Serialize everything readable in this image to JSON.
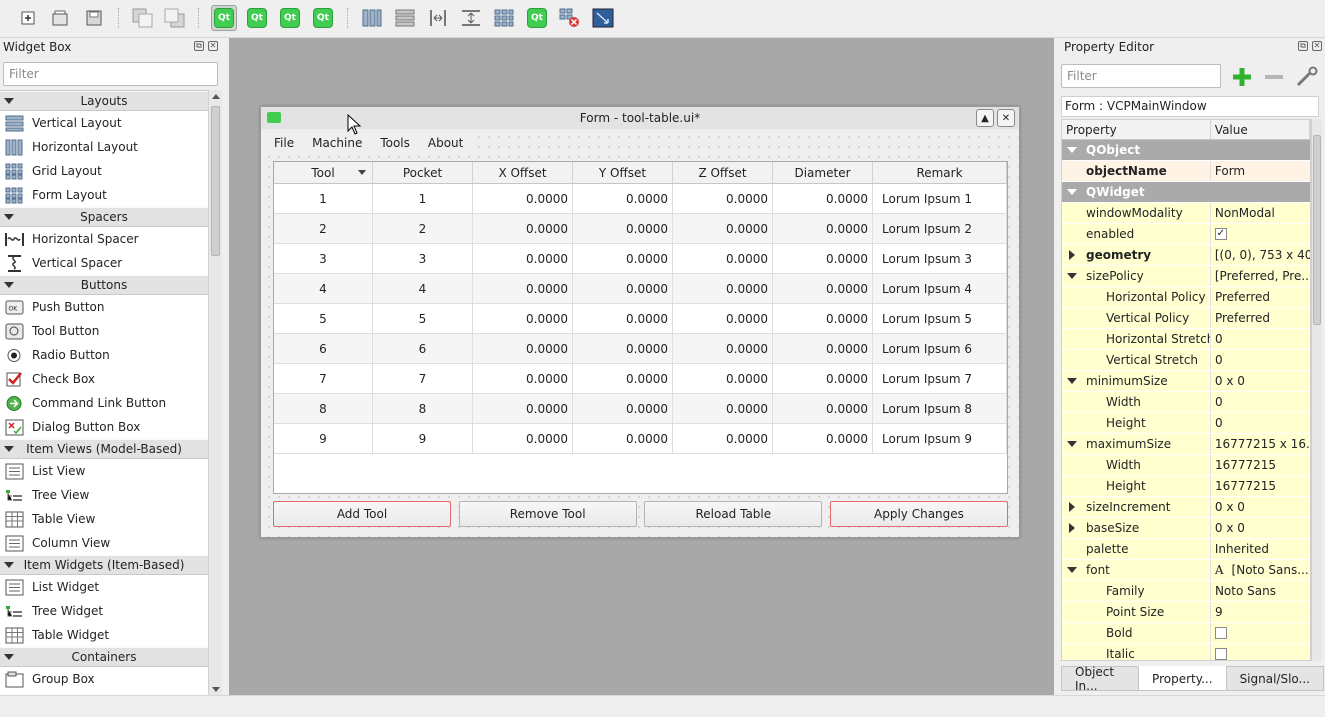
{
  "toolbar": {
    "buttons": [
      "new-form-icon",
      "open-form-icon",
      "save-form-icon",
      "send-to-back-icon",
      "bring-to-front-icon",
      "edit-widgets-icon",
      "edit-signals-slots-icon",
      "edit-buddies-icon",
      "edit-tab-order-icon",
      "layout-horizontally-icon",
      "layout-vertically-icon",
      "layout-horizontal-splitter-icon",
      "layout-vertical-splitter-icon",
      "layout-grid-icon",
      "layout-form-icon",
      "break-layout-icon",
      "adjust-size-icon"
    ],
    "qt_badge_text": "Qt"
  },
  "widget_box": {
    "title": "Widget Box",
    "filter_placeholder": "Filter",
    "categories": [
      {
        "label": "Layouts",
        "items": [
          "Vertical Layout",
          "Horizontal Layout",
          "Grid Layout",
          "Form Layout"
        ]
      },
      {
        "label": "Spacers",
        "items": [
          "Horizontal Spacer",
          "Vertical Spacer"
        ]
      },
      {
        "label": "Buttons",
        "items": [
          "Push Button",
          "Tool Button",
          "Radio Button",
          "Check Box",
          "Command Link Button",
          "Dialog Button Box"
        ]
      },
      {
        "label": "Item Views (Model-Based)",
        "items": [
          "List View",
          "Tree View",
          "Table View",
          "Column View"
        ]
      },
      {
        "label": "Item Widgets (Item-Based)",
        "items": [
          "List Widget",
          "Tree Widget",
          "Table Widget"
        ]
      },
      {
        "label": "Containers",
        "items": [
          "Group Box"
        ]
      }
    ]
  },
  "form": {
    "title": "Form - tool-table.ui*",
    "menu": [
      "File",
      "Machine",
      "Tools",
      "About"
    ],
    "table": {
      "headers": [
        "Tool",
        "Pocket",
        "X Offset",
        "Y Offset",
        "Z Offset",
        "Diameter",
        "Remark"
      ],
      "rows": [
        [
          "1",
          "1",
          "0.0000",
          "0.0000",
          "0.0000",
          "0.0000",
          "Lorum Ipsum 1"
        ],
        [
          "2",
          "2",
          "0.0000",
          "0.0000",
          "0.0000",
          "0.0000",
          "Lorum Ipsum 2"
        ],
        [
          "3",
          "3",
          "0.0000",
          "0.0000",
          "0.0000",
          "0.0000",
          "Lorum Ipsum 3"
        ],
        [
          "4",
          "4",
          "0.0000",
          "0.0000",
          "0.0000",
          "0.0000",
          "Lorum Ipsum 4"
        ],
        [
          "5",
          "5",
          "0.0000",
          "0.0000",
          "0.0000",
          "0.0000",
          "Lorum Ipsum 5"
        ],
        [
          "6",
          "6",
          "0.0000",
          "0.0000",
          "0.0000",
          "0.0000",
          "Lorum Ipsum 6"
        ],
        [
          "7",
          "7",
          "0.0000",
          "0.0000",
          "0.0000",
          "0.0000",
          "Lorum Ipsum 7"
        ],
        [
          "8",
          "8",
          "0.0000",
          "0.0000",
          "0.0000",
          "0.0000",
          "Lorum Ipsum 8"
        ],
        [
          "9",
          "9",
          "0.0000",
          "0.0000",
          "0.0000",
          "0.0000",
          "Lorum Ipsum 9"
        ]
      ]
    },
    "buttons": [
      "Add Tool",
      "Remove Tool",
      "Reload Table",
      "Apply Changes"
    ]
  },
  "property_editor": {
    "title": "Property Editor",
    "filter_placeholder": "Filter",
    "object_label": "Form : VCPMainWindow",
    "headers": [
      "Property",
      "Value"
    ],
    "rows": [
      {
        "name": "QObject",
        "value": "",
        "kind": "group",
        "indent": 0,
        "exp": "down"
      },
      {
        "name": "objectName",
        "value": "Form",
        "kind": "o",
        "indent": 1,
        "bold": true
      },
      {
        "name": "QWidget",
        "value": "",
        "kind": "group",
        "indent": 0,
        "exp": "down"
      },
      {
        "name": "windowModality",
        "value": "NonModal",
        "kind": "y",
        "indent": 1
      },
      {
        "name": "enabled",
        "value": "✓",
        "kind": "y",
        "indent": 1,
        "check": true
      },
      {
        "name": "geometry",
        "value": "[(0, 0), 753 x 40...",
        "kind": "y",
        "indent": 1,
        "bold": true,
        "exp": "right"
      },
      {
        "name": "sizePolicy",
        "value": "[Preferred, Pre...",
        "kind": "y",
        "indent": 1,
        "exp": "down"
      },
      {
        "name": "Horizontal Policy",
        "value": "Preferred",
        "kind": "y",
        "indent": 2
      },
      {
        "name": "Vertical Policy",
        "value": "Preferred",
        "kind": "y",
        "indent": 2
      },
      {
        "name": "Horizontal Stretch",
        "value": "0",
        "kind": "y",
        "indent": 2
      },
      {
        "name": "Vertical Stretch",
        "value": "0",
        "kind": "y",
        "indent": 2
      },
      {
        "name": "minimumSize",
        "value": "0 x 0",
        "kind": "y",
        "indent": 1,
        "exp": "down"
      },
      {
        "name": "Width",
        "value": "0",
        "kind": "y",
        "indent": 2
      },
      {
        "name": "Height",
        "value": "0",
        "kind": "y",
        "indent": 2
      },
      {
        "name": "maximumSize",
        "value": "16777215 x 16...",
        "kind": "y",
        "indent": 1,
        "exp": "down"
      },
      {
        "name": "Width",
        "value": "16777215",
        "kind": "y",
        "indent": 2
      },
      {
        "name": "Height",
        "value": "16777215",
        "kind": "y",
        "indent": 2
      },
      {
        "name": "sizeIncrement",
        "value": "0 x 0",
        "kind": "y",
        "indent": 1,
        "exp": "right"
      },
      {
        "name": "baseSize",
        "value": "0 x 0",
        "kind": "y",
        "indent": 1,
        "exp": "right"
      },
      {
        "name": "palette",
        "value": "Inherited",
        "kind": "y",
        "indent": 1
      },
      {
        "name": "font",
        "value": "[Noto Sans...",
        "kind": "y",
        "indent": 1,
        "exp": "down",
        "fonticon": true
      },
      {
        "name": "Family",
        "value": "Noto Sans",
        "kind": "y",
        "indent": 2
      },
      {
        "name": "Point Size",
        "value": "9",
        "kind": "y",
        "indent": 2
      },
      {
        "name": "Bold",
        "value": "",
        "kind": "y",
        "indent": 2,
        "check": true
      },
      {
        "name": "Italic",
        "value": "",
        "kind": "y",
        "indent": 2,
        "check": true
      }
    ],
    "tabs": [
      "Object In...",
      "Property...",
      "Signal/Slo..."
    ],
    "active_tab": 1
  }
}
